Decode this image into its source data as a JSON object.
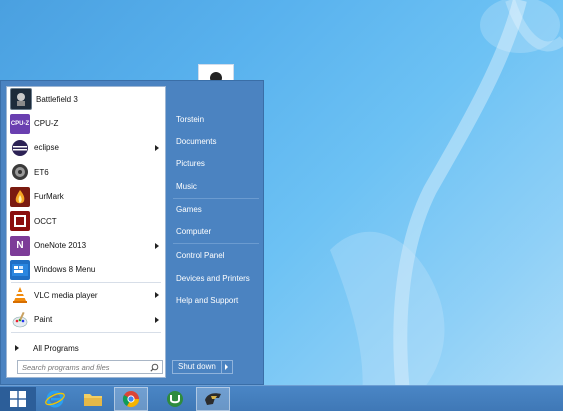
{
  "programs": [
    {
      "label": "Battlefield 3",
      "icon": "battlefield-icon",
      "submenu": false
    },
    {
      "label": "CPU-Z",
      "icon": "cpuz-icon",
      "submenu": false
    },
    {
      "label": "eclipse",
      "icon": "eclipse-icon",
      "submenu": true
    },
    {
      "label": "ET6",
      "icon": "et6-icon",
      "submenu": false
    },
    {
      "label": "FurMark",
      "icon": "furmark-icon",
      "submenu": false
    },
    {
      "label": "OCCT",
      "icon": "occt-icon",
      "submenu": false
    },
    {
      "label": "OneNote 2013",
      "icon": "onenote-icon",
      "submenu": true
    },
    {
      "label": "Windows 8 Menu",
      "icon": "windows8menu-icon",
      "submenu": false
    },
    {
      "label": "VLC media player",
      "icon": "vlc-icon",
      "submenu": true
    },
    {
      "label": "Paint",
      "icon": "paint-icon",
      "submenu": true
    }
  ],
  "all_programs_label": "All Programs",
  "search": {
    "placeholder": "Search programs and files"
  },
  "right_links": {
    "user": "Torstein",
    "documents": "Documents",
    "pictures": "Pictures",
    "music": "Music",
    "games": "Games",
    "computer": "Computer",
    "control_panel": "Control Panel",
    "devices": "Devices and Printers",
    "help": "Help and Support"
  },
  "shutdown_label": "Shut down",
  "taskbar": {
    "items": [
      "start-icon",
      "internet-explorer-icon",
      "file-explorer-icon",
      "chrome-icon",
      "utorrent-icon",
      "game-icon"
    ],
    "active": "chrome-icon"
  },
  "colors": {
    "menu_blue": "#4b83c1",
    "taskbar_blue": "#3f78b6",
    "accent": "#2c5e99"
  }
}
